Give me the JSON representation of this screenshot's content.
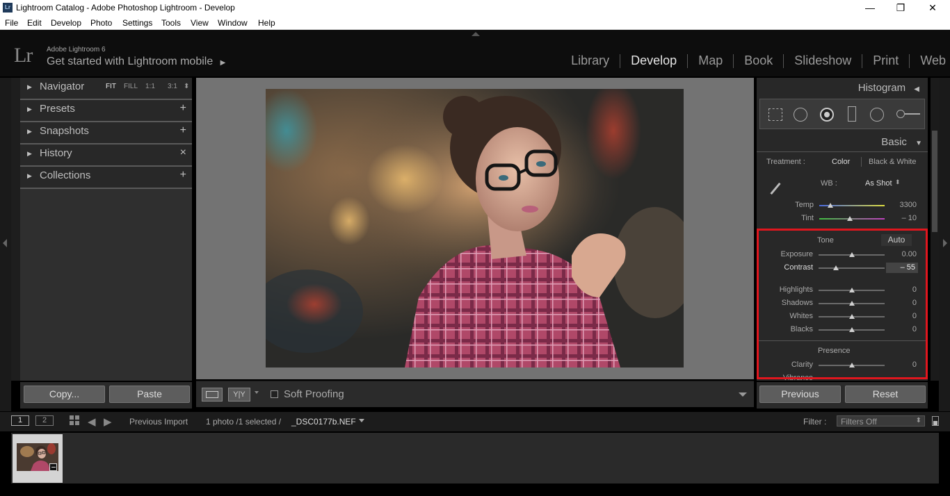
{
  "window": {
    "title": "Lightroom Catalog - Adobe Photoshop Lightroom - Develop",
    "app_icon": "Lr",
    "controls": {
      "minimize": "—",
      "restore": "❐",
      "close": "✕"
    }
  },
  "menu": [
    "File",
    "Edit",
    "Develop",
    "Photo",
    "Settings",
    "Tools",
    "View",
    "Window",
    "Help"
  ],
  "identity": {
    "logo": "Lr",
    "small": "Adobe Lightroom 6",
    "big": "Get started with Lightroom mobile",
    "arrow": "▶"
  },
  "modules": [
    "Library",
    "Develop",
    "Map",
    "Book",
    "Slideshow",
    "Print",
    "Web"
  ],
  "active_module": "Develop",
  "left_panel": {
    "navigator": {
      "label": "Navigator",
      "zoom": [
        "FIT",
        "FILL",
        "1:1",
        "3:1"
      ],
      "zoom_arrow": "⬍"
    },
    "presets": {
      "label": "Presets",
      "action": "+"
    },
    "snapshots": {
      "label": "Snapshots",
      "action": "+"
    },
    "history": {
      "label": "History",
      "action": "×"
    },
    "collections": {
      "label": "Collections",
      "action": "+"
    }
  },
  "toolbar": {
    "soft_proofing": "Soft Proofing",
    "view_compare": "Y|Y"
  },
  "right_panel": {
    "histogram": "Histogram",
    "basic": "Basic",
    "treatment_label": "Treatment :",
    "treatment_color": "Color",
    "treatment_bw": "Black & White",
    "wb_label": "WB :",
    "wb_value": "As Shot",
    "temp": {
      "label": "Temp",
      "value": "3300"
    },
    "tint": {
      "label": "Tint",
      "value": "– 10"
    },
    "tone_label": "Tone",
    "auto": "Auto",
    "exposure": {
      "label": "Exposure",
      "value": "0.00"
    },
    "contrast": {
      "label": "Contrast",
      "value": "– 55"
    },
    "highlights": {
      "label": "Highlights",
      "value": "0"
    },
    "shadows": {
      "label": "Shadows",
      "value": "0"
    },
    "whites": {
      "label": "Whites",
      "value": "0"
    },
    "blacks": {
      "label": "Blacks",
      "value": "0"
    },
    "presence_label": "Presence",
    "clarity": {
      "label": "Clarity",
      "value": "0"
    },
    "vibrance": {
      "label": "Vibrance"
    }
  },
  "buttons": {
    "copy": "Copy...",
    "paste": "Paste",
    "previous": "Previous",
    "reset": "Reset"
  },
  "filmstrip": {
    "screen1": "1",
    "screen2": "2",
    "source": "Previous Import",
    "info": "1 photo /1 selected /",
    "filename": "_DSC0177b.NEF",
    "filter_label": "Filter :",
    "filter_value": "Filters Off"
  }
}
